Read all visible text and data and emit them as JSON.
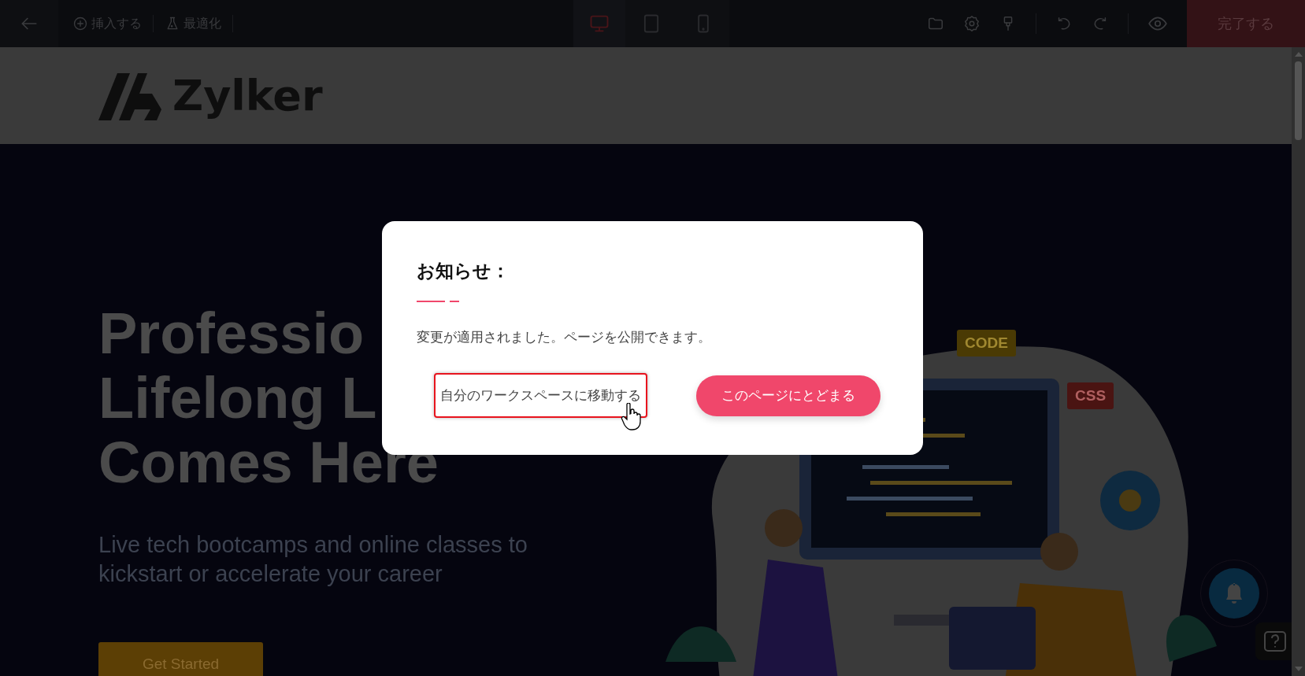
{
  "toolbar": {
    "tools": [
      {
        "kind": "insert",
        "label": "挿入する"
      },
      {
        "kind": "optimize",
        "label": "最適化"
      }
    ],
    "devices": [
      {
        "kind": "desktop",
        "selected": true
      },
      {
        "kind": "tablet",
        "selected": false
      },
      {
        "kind": "mobile",
        "selected": false
      }
    ],
    "done_button": "完了する"
  },
  "site": {
    "logo": "Zylker",
    "heading_lines": [
      "Professio",
      "Lifelong L",
      "Comes Here"
    ],
    "subtitle_lines": [
      "Live tech bootcamps and online classes to",
      "kickstart or accelerate your career"
    ],
    "cta": "Get Started",
    "illustration_tags": [
      "CODE",
      "CSS"
    ]
  },
  "dialog": {
    "title": "お知らせ：",
    "message": "変更が適用されました。ページを公開できます。",
    "buttons": [
      {
        "kind": "outline",
        "label": "自分のワークスペースに移動する",
        "focused": true
      },
      {
        "kind": "primary",
        "label": "このページにとどまる",
        "focused": false
      }
    ]
  }
}
